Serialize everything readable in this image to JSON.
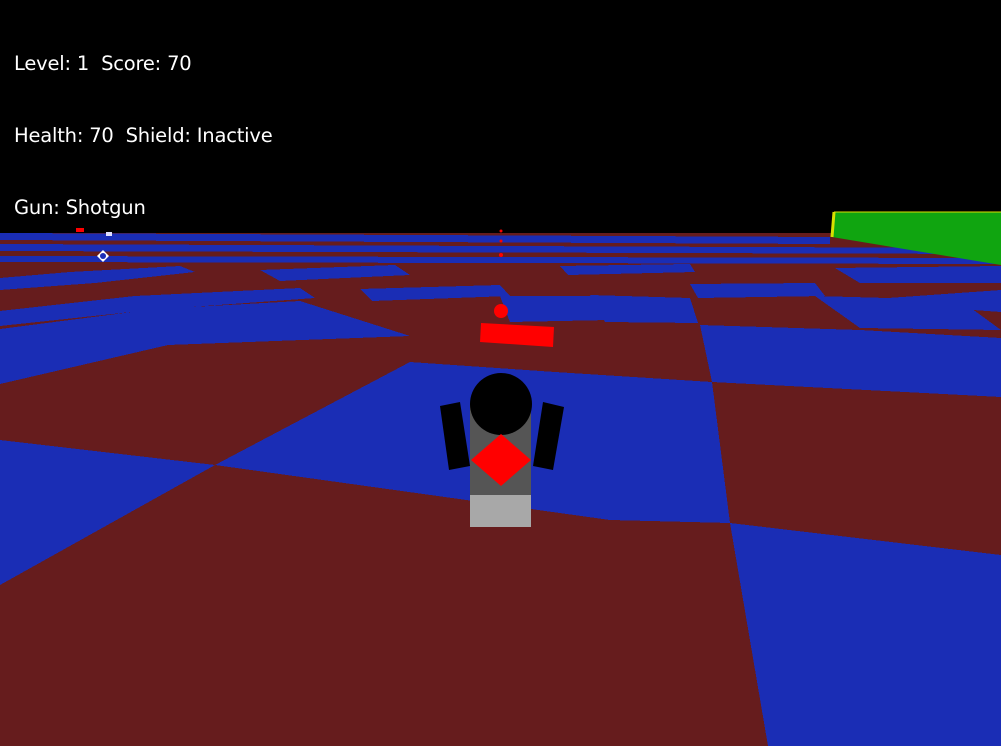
{
  "hud": {
    "level_label": "Level:",
    "level_value": "1",
    "score_label": "Score:",
    "score_value": "70",
    "health_label": "Health:",
    "health_value": "70",
    "shield_label": "Shield:",
    "shield_value": "Inactive",
    "gun_label": "Gun:",
    "gun_value": "Shotgun"
  },
  "colors": {
    "sky": "#000000",
    "floor_tile_a": "#1a2db5",
    "floor_tile_b": "#661c1d",
    "wall": "#10a510",
    "wall_edge": "#d8e000",
    "projectile": "#ff0000",
    "player_head": "#000000",
    "player_body": "#555555",
    "player_legs": "#a8a8a8",
    "player_emblem": "#ff0000",
    "hud_text": "#ffffff"
  }
}
